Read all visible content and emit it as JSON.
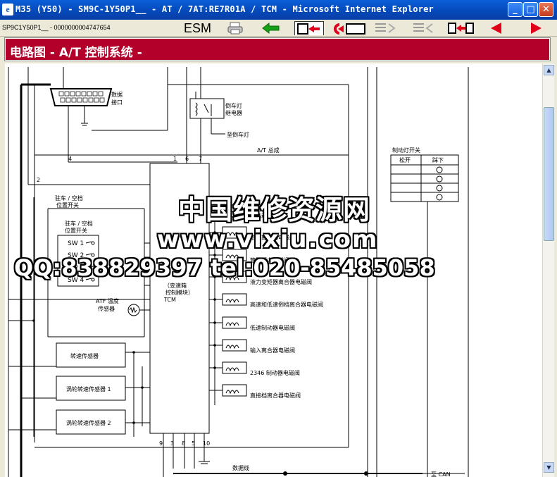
{
  "window": {
    "title": "M35 (Y50) - SM9C-1Y50P1__ - AT / 7AT:RE7R01A / TCM - Microsoft Internet Explorer",
    "minimize": "_",
    "maximize": "□",
    "close": "✕"
  },
  "toolbar": {
    "doc_id": "SP9C1Y50P1__ - 0000000004747654",
    "esm_label": "ESM",
    "icons": [
      "printer-icon",
      "green-back-arrow-icon",
      "jump-out-icon",
      "jump-in-icon",
      "list-icon",
      "list-back-icon",
      "pages-icon",
      "red-prev-arrow-icon",
      "red-next-arrow-icon"
    ],
    "accent_red": "#b3002a",
    "arrow_red": "#e0001a",
    "arrow_green": "#18a018"
  },
  "banner": {
    "title": "电路图 - A/T 控制系统 -"
  },
  "diagram": {
    "data_connector": "数据\n接口",
    "backup_relay": "倒车灯\n继电器",
    "to_backup_lamp": "至倒车灯",
    "at_assembly": "A/T 总成",
    "brake_switch": "制动灯开关",
    "brake_released": "松开",
    "brake_pressed": "踩下",
    "park_neutral_outer": "驻车 / 空档\n位置开关",
    "park_neutral_inner": "驻车 / 空档\n位置开关",
    "sw_labels": [
      "SW 1",
      "SW 2",
      "SW 3",
      "SW 4"
    ],
    "atf_sensor": "ATF 温度\n传感器",
    "speed_sensor": "转速传感器",
    "turbine_sensor_1": "涡轮转速传感器 1",
    "turbine_sensor_2": "涡轮转速传感器 2",
    "tcm_label": "TCM\n（变速箱\n控制模块）",
    "solenoids": [
      "前制动电磁阀",
      "低速离合器电磁阀",
      "管路压力电磁阀",
      "液力变矩器离合器电磁阀",
      "高速和低速倒档离合器电磁阀",
      "低速制动器电磁阀",
      "输入离合器电磁阀",
      "2346 制动器电磁阀",
      "直接档离合器电磁阀"
    ],
    "pins_top": [
      "1",
      "6",
      "7"
    ],
    "pins_bottom": [
      "9",
      "3",
      "8",
      "5",
      "10"
    ],
    "wire_left_4": "4",
    "wire_left_2": "2",
    "data_line": "数据线",
    "to_can": "至 CAN"
  },
  "watermark": {
    "line1": "中国维修资源网",
    "line2": "www.vixiu.com",
    "line3": "QQ:838829397  tel:020-85485058"
  }
}
